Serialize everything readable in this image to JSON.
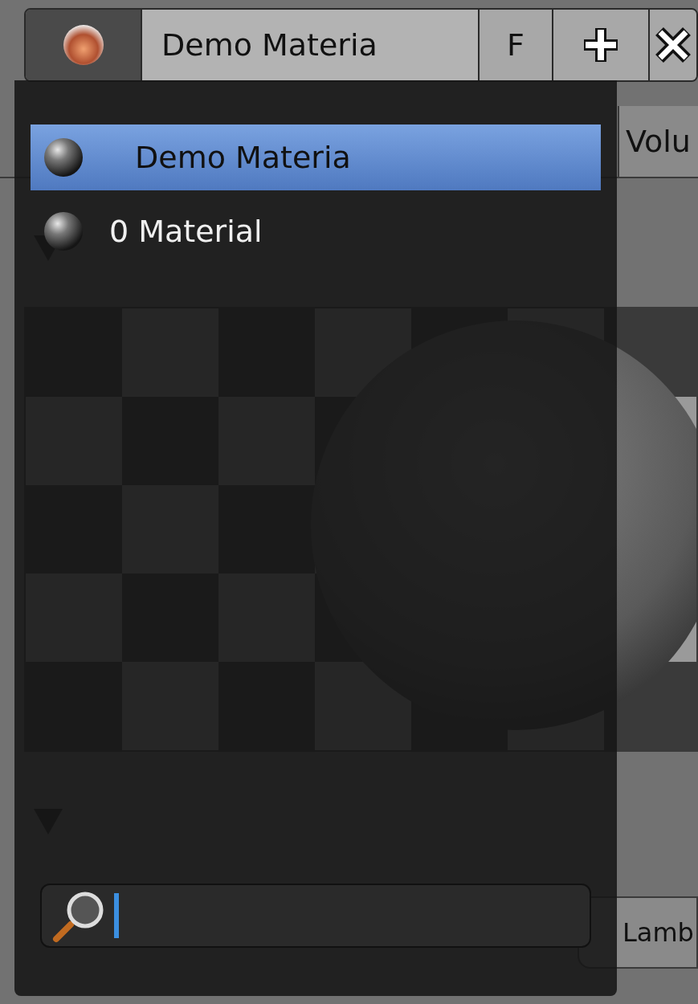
{
  "header": {
    "material_name": "Demo Materia",
    "fake_user_label": "F"
  },
  "tabs": [
    {
      "label": "Volu"
    }
  ],
  "diffuse_shader": "Lamb",
  "dropdown": {
    "items": [
      {
        "label": "Demo Materia",
        "selected": true
      },
      {
        "label": "0 Material",
        "selected": false
      }
    ],
    "search": {
      "focused": true
    }
  }
}
